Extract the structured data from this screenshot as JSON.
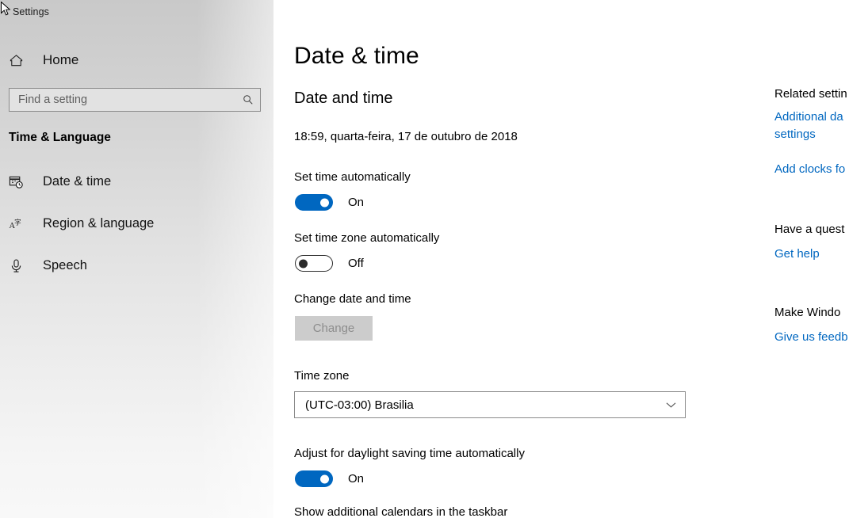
{
  "window": {
    "app_title": "Settings"
  },
  "sidebar": {
    "home_label": "Home",
    "home_icon": "home-icon",
    "search": {
      "placeholder": "Find a setting",
      "value": "",
      "icon": "search-icon"
    },
    "category_title": "Time & Language",
    "items": [
      {
        "label": "Date & time",
        "icon": "calendar-clock-icon",
        "selected": true
      },
      {
        "label": "Region & language",
        "icon": "language-icon",
        "selected": false
      },
      {
        "label": "Speech",
        "icon": "microphone-icon",
        "selected": false
      }
    ]
  },
  "main": {
    "page_title": "Date & time",
    "section_title": "Date and time",
    "current_datetime": "18:59, quarta-feira, 17 de outubro de 2018",
    "set_time_automatically": {
      "label": "Set time automatically",
      "state_label": "On",
      "state": "on"
    },
    "set_timezone_automatically": {
      "label": "Set time zone automatically",
      "state_label": "Off",
      "state": "off"
    },
    "change_date_time": {
      "label": "Change date and time",
      "button_label": "Change",
      "disabled": true
    },
    "time_zone": {
      "label": "Time zone",
      "selected": "(UTC-03:00) Brasilia",
      "chevron_icon": "chevron-down-icon"
    },
    "daylight_saving": {
      "label": "Adjust for daylight saving time automatically",
      "state_label": "On",
      "state": "on"
    },
    "additional_calendars": {
      "label": "Show additional calendars in the taskbar"
    }
  },
  "right_panel": {
    "related_settings_heading": "Related settin",
    "additional_settings_link": "Additional da settings",
    "add_clocks_link": "Add clocks fo",
    "question_heading": "Have a quest",
    "get_help_link": "Get help",
    "make_windows_heading": "Make Windo",
    "feedback_link": "Give us feedb"
  },
  "colors": {
    "accent": "#0067c0",
    "link": "#0067c0",
    "toggle_off_border": "#2b2b2b",
    "disabled_button_bg": "#cccccc",
    "disabled_button_text": "#8d8d8d"
  }
}
